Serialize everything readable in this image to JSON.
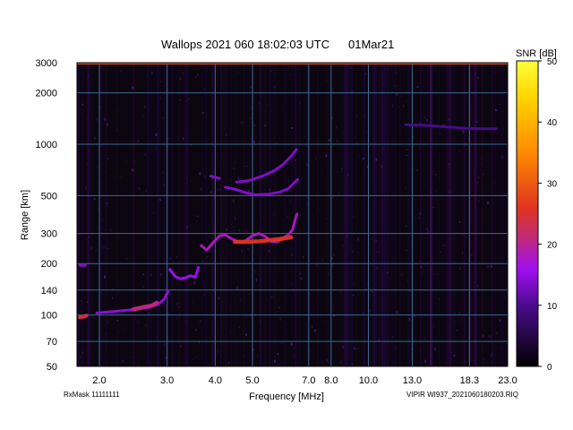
{
  "chart_data": {
    "type": "heatmap",
    "title": "Wallops 2021 060 18:02:03 UTC",
    "date": "01Mar21",
    "xlabel": "Frequency [MHz]",
    "ylabel": "Range [km]",
    "x_scale": "log",
    "y_scale": "log",
    "xlim": [
      1.75,
      23.0
    ],
    "ylim": [
      50,
      3000
    ],
    "x_ticks": [
      {
        "value": 2.0,
        "label": "2.0"
      },
      {
        "value": 3.0,
        "label": "3.0"
      },
      {
        "value": 4.0,
        "label": "4.0"
      },
      {
        "value": 5.0,
        "label": "5.0"
      },
      {
        "value": 7.0,
        "label": "7.0"
      },
      {
        "value": 8.0,
        "label": "8.0"
      },
      {
        "value": 10.0,
        "label": "10.0"
      },
      {
        "value": 13.0,
        "label": "13.0"
      },
      {
        "value": 18.3,
        "label": "18.3"
      },
      {
        "value": 23.0,
        "label": "23.0"
      }
    ],
    "y_ticks": [
      {
        "value": 50,
        "label": "50"
      },
      {
        "value": 70,
        "label": "70"
      },
      {
        "value": 100,
        "label": "100"
      },
      {
        "value": 140,
        "label": "140"
      },
      {
        "value": 200,
        "label": "200"
      },
      {
        "value": 300,
        "label": "300"
      },
      {
        "value": 500,
        "label": "500"
      },
      {
        "value": 1000,
        "label": "1000"
      },
      {
        "value": 2000,
        "label": "2000"
      },
      {
        "value": 3000,
        "label": "3000"
      }
    ],
    "grid": true,
    "colorbar": {
      "label": "SNR [dB]",
      "range": [
        0,
        50
      ],
      "ticks": [
        {
          "value": 0,
          "label": "0"
        },
        {
          "value": 10,
          "label": "10"
        },
        {
          "value": 20,
          "label": "20"
        },
        {
          "value": 30,
          "label": "30"
        },
        {
          "value": 40,
          "label": "40"
        },
        {
          "value": 50,
          "label": "50"
        }
      ]
    },
    "traces": [
      {
        "snr": 24,
        "points": [
          [
            1.78,
            97
          ],
          [
            1.82,
            98
          ],
          [
            1.85,
            99
          ]
        ]
      },
      {
        "snr": 14,
        "points": [
          [
            1.78,
            195
          ],
          [
            1.84,
            195
          ]
        ]
      },
      {
        "snr": 15,
        "points": [
          [
            1.97,
            103
          ],
          [
            2.1,
            104
          ],
          [
            2.3,
            106
          ],
          [
            2.5,
            108
          ],
          [
            2.7,
            111
          ],
          [
            2.85,
            116
          ],
          [
            2.95,
            124
          ],
          [
            3.02,
            138
          ]
        ]
      },
      {
        "snr": 21,
        "points": [
          [
            2.45,
            108
          ],
          [
            2.55,
            110
          ],
          [
            2.65,
            112
          ],
          [
            2.75,
            114
          ],
          [
            2.82,
            118
          ]
        ]
      },
      {
        "snr": 16,
        "points": [
          [
            3.05,
            185
          ],
          [
            3.15,
            168
          ],
          [
            3.25,
            163
          ],
          [
            3.35,
            165
          ],
          [
            3.45,
            170
          ],
          [
            3.55,
            166
          ],
          [
            3.62,
            190
          ]
        ]
      },
      {
        "snr": 18,
        "points": [
          [
            3.68,
            255
          ],
          [
            3.8,
            240
          ],
          [
            3.95,
            265
          ],
          [
            4.1,
            290
          ],
          [
            4.25,
            295
          ],
          [
            4.4,
            280
          ],
          [
            4.6,
            268
          ],
          [
            4.8,
            272
          ],
          [
            5.0,
            292
          ],
          [
            5.2,
            300
          ],
          [
            5.4,
            288
          ],
          [
            5.6,
            270
          ],
          [
            5.8,
            268
          ],
          [
            6.0,
            282
          ],
          [
            6.2,
            295
          ],
          [
            6.35,
            315
          ],
          [
            6.45,
            360
          ],
          [
            6.52,
            390
          ]
        ]
      },
      {
        "snr": 26,
        "points": [
          [
            4.5,
            268
          ],
          [
            4.8,
            268
          ],
          [
            5.2,
            270
          ],
          [
            5.6,
            275
          ],
          [
            6.0,
            280
          ],
          [
            6.3,
            285
          ]
        ]
      },
      {
        "snr": 14,
        "points": [
          [
            3.9,
            650
          ],
          [
            4.1,
            630
          ]
        ]
      },
      {
        "snr": 14,
        "points": [
          [
            4.25,
            560
          ],
          [
            4.5,
            545
          ],
          [
            4.8,
            520
          ],
          [
            5.1,
            505
          ],
          [
            5.5,
            510
          ],
          [
            5.9,
            525
          ],
          [
            6.2,
            550
          ],
          [
            6.4,
            590
          ],
          [
            6.55,
            620
          ]
        ]
      },
      {
        "snr": 14,
        "points": [
          [
            4.55,
            600
          ],
          [
            4.9,
            612
          ],
          [
            5.3,
            650
          ],
          [
            5.7,
            700
          ],
          [
            6.0,
            760
          ],
          [
            6.3,
            850
          ],
          [
            6.5,
            930
          ]
        ]
      },
      {
        "snr": 10,
        "points": [
          [
            12.5,
            1300
          ],
          [
            14.0,
            1290
          ],
          [
            16.0,
            1260
          ],
          [
            18.0,
            1240
          ],
          [
            20.0,
            1230
          ],
          [
            21.5,
            1230
          ]
        ]
      }
    ]
  },
  "footer": {
    "rxmask": "RxMask 11111111",
    "file": "VIPIR  WI937_2021060180203.RIQ"
  }
}
